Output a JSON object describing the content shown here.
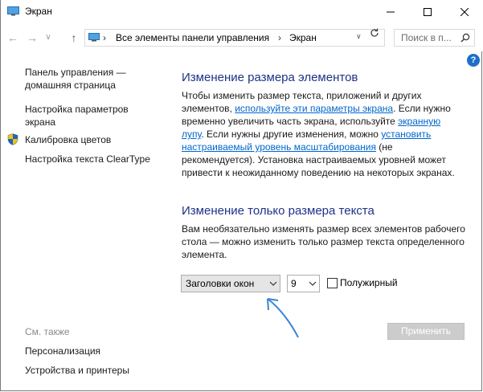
{
  "window": {
    "title": "Экран",
    "controls": [
      "minimize-icon",
      "maximize-icon",
      "close-icon"
    ]
  },
  "addressbar": {
    "breadcrumbs": [
      "Все элементы панели управления",
      "Экран"
    ],
    "search_placeholder": "Поиск в п..."
  },
  "help_label": "?",
  "sidebar": {
    "links": [
      {
        "label": "Панель управления — домашняя страница"
      },
      {
        "label": "Настройка параметров экрана"
      },
      {
        "label": "Калибровка цветов",
        "icon": "shield-icon"
      },
      {
        "label": "Настройка текста ClearType"
      }
    ],
    "see_also_label": "См. также",
    "see_also": [
      "Персонализация",
      "Устройства и принтеры"
    ]
  },
  "main": {
    "section1": {
      "heading": "Изменение размера элементов",
      "p1": "Чтобы изменить размер текста, приложений и других элементов,",
      "link1": "используйте эти параметры экрана",
      "p2": ". Если нужно временно увеличить часть экрана, используйте ",
      "link2": "экранную лупу",
      "p3": ". Если нужны другие изменения, можно ",
      "link3": "установить настраиваемый уровень масштабирования",
      "p4": " (не рекомендуется). Установка настраиваемых уровней может привести к неожиданному поведению на некоторых экранах."
    },
    "section2": {
      "heading": "Изменение только размера текста",
      "text": "Вам необязательно изменять размер всех элементов рабочего стола — можно изменить только размер текста определенного элемента.",
      "element_select": "Заголовки окон",
      "size_select": "9",
      "bold_checkbox_label": "Полужирный",
      "bold_checked": false
    },
    "apply_label": "Применить"
  },
  "colors": {
    "heading": "#1e3287",
    "link": "#0066cc",
    "annotation_arrow": "#3a84d0"
  }
}
